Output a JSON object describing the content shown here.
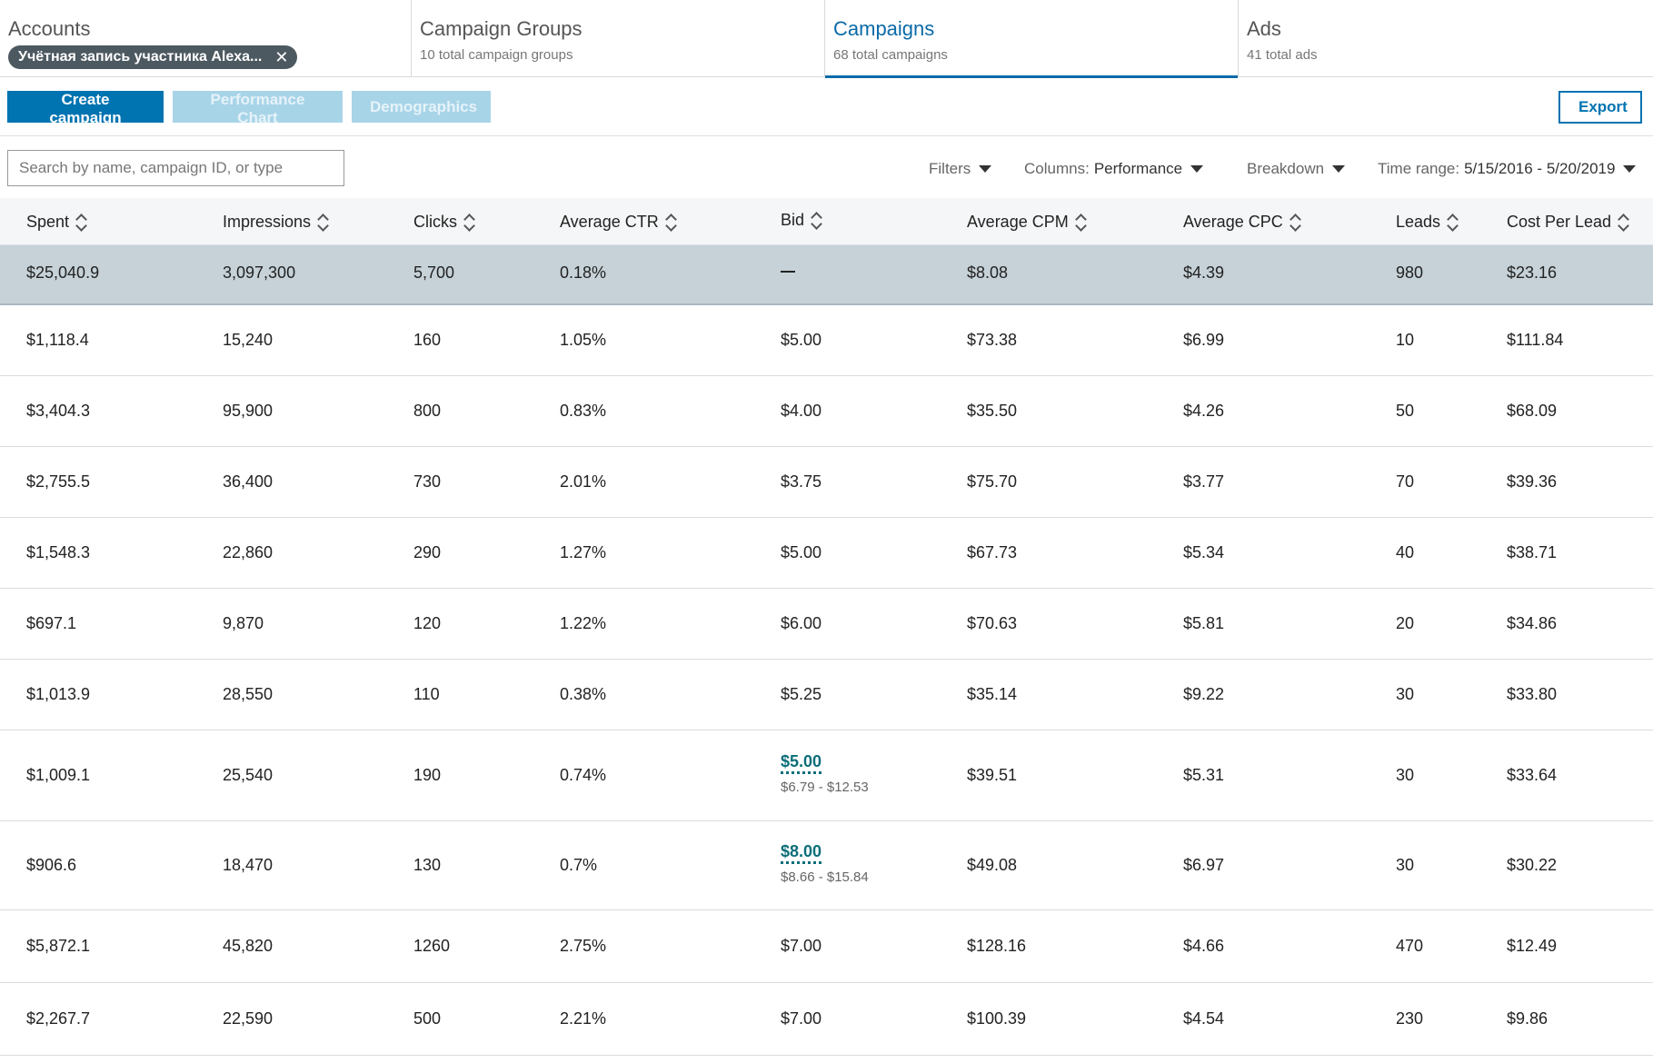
{
  "tabs": [
    {
      "title": "Accounts",
      "chip": "Учётная запись участника Alexa...",
      "chip_close": "✕"
    },
    {
      "title": "Campaign Groups",
      "sub": "10 total campaign groups"
    },
    {
      "title": "Campaigns",
      "sub": "68 total campaigns",
      "active": true
    },
    {
      "title": "Ads",
      "sub": "41 total ads"
    }
  ],
  "toolbar": {
    "create": "Create campaign",
    "performance": "Performance Chart",
    "demographics": "Demographics",
    "export": "Export"
  },
  "filters": {
    "search_placeholder": "Search by name, campaign ID, or type",
    "filters_label": "Filters",
    "columns_label": "Columns:",
    "columns_value": "Performance",
    "breakdown_label": "Breakdown",
    "time_label": "Time range:",
    "time_value": "5/15/2016 - 5/20/2019"
  },
  "table": {
    "headers": [
      "Spent",
      "Impressions",
      "Clicks",
      "Average CTR",
      "Bid",
      "Average CPM",
      "Average CPC",
      "Leads",
      "Cost Per Lead"
    ],
    "total": {
      "spent": "$25,040.9",
      "impressions": "3,097,300",
      "clicks": "5,700",
      "ctr": "0.18%",
      "bid": "",
      "cpm": "$8.08",
      "cpc": "$4.39",
      "leads": "980",
      "cpl": "$23.16"
    },
    "rows": [
      {
        "spent": "$1,118.4",
        "impressions": "15,240",
        "clicks": "160",
        "ctr": "1.05%",
        "bid": "$5.00",
        "cpm": "$73.38",
        "cpc": "$6.99",
        "leads": "10",
        "cpl": "$111.84"
      },
      {
        "spent": "$3,404.3",
        "impressions": "95,900",
        "clicks": "800",
        "ctr": "0.83%",
        "bid": "$4.00",
        "cpm": "$35.50",
        "cpc": "$4.26",
        "leads": "50",
        "cpl": "$68.09"
      },
      {
        "spent": "$2,755.5",
        "impressions": "36,400",
        "clicks": "730",
        "ctr": "2.01%",
        "bid": "$3.75",
        "cpm": "$75.70",
        "cpc": "$3.77",
        "leads": "70",
        "cpl": "$39.36"
      },
      {
        "spent": "$1,548.3",
        "impressions": "22,860",
        "clicks": "290",
        "ctr": "1.27%",
        "bid": "$5.00",
        "cpm": "$67.73",
        "cpc": "$5.34",
        "leads": "40",
        "cpl": "$38.71"
      },
      {
        "spent": "$697.1",
        "impressions": "9,870",
        "clicks": "120",
        "ctr": "1.22%",
        "bid": "$6.00",
        "cpm": "$70.63",
        "cpc": "$5.81",
        "leads": "20",
        "cpl": "$34.86"
      },
      {
        "spent": "$1,013.9",
        "impressions": "28,550",
        "clicks": "110",
        "ctr": "0.38%",
        "bid": "$5.25",
        "cpm": "$35.14",
        "cpc": "$9.22",
        "leads": "30",
        "cpl": "$33.80"
      },
      {
        "spent": "$1,009.1",
        "impressions": "25,540",
        "clicks": "190",
        "ctr": "0.74%",
        "bid": "$5.00",
        "bid_range": "$6.79 - $12.53",
        "cpm": "$39.51",
        "cpc": "$5.31",
        "leads": "30",
        "cpl": "$33.64"
      },
      {
        "spent": "$906.6",
        "impressions": "18,470",
        "clicks": "130",
        "ctr": "0.7%",
        "bid": "$8.00",
        "bid_range": "$8.66 - $15.84",
        "cpm": "$49.08",
        "cpc": "$6.97",
        "leads": "30",
        "cpl": "$30.22"
      },
      {
        "spent": "$5,872.1",
        "impressions": "45,820",
        "clicks": "1260",
        "ctr": "2.75%",
        "bid": "$7.00",
        "cpm": "$128.16",
        "cpc": "$4.66",
        "leads": "470",
        "cpl": "$12.49"
      },
      {
        "spent": "$2,267.7",
        "impressions": "22,590",
        "clicks": "500",
        "ctr": "2.21%",
        "bid": "$7.00",
        "cpm": "$100.39",
        "cpc": "$4.54",
        "leads": "230",
        "cpl": "$9.86"
      }
    ]
  }
}
